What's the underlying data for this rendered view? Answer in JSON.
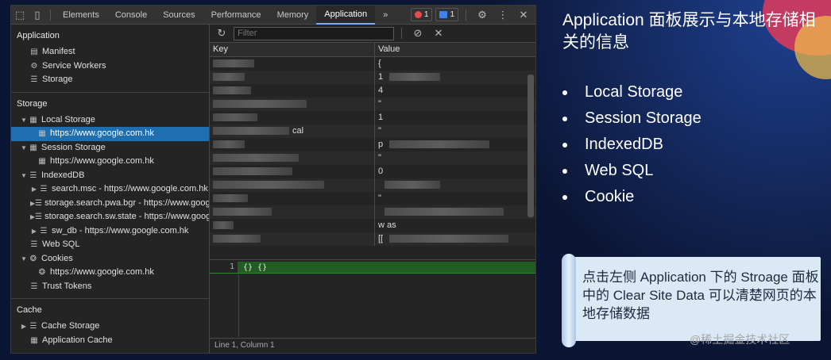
{
  "devtools": {
    "tabs": [
      "Elements",
      "Console",
      "Sources",
      "Performance",
      "Memory",
      "Application"
    ],
    "active_tab": "Application",
    "more_tabs": "»",
    "error_count": "1",
    "message_count": "1",
    "sidebar": {
      "application_header": "Application",
      "application_items": [
        "Manifest",
        "Service Workers",
        "Storage"
      ],
      "storage_header": "Storage",
      "local_storage": "Local Storage",
      "local_storage_origin": "https://www.google.com.hk",
      "session_storage": "Session Storage",
      "session_storage_origin": "https://www.google.com.hk",
      "indexeddb": "IndexedDB",
      "indexeddb_items": [
        "search.msc - https://www.google.com.hk",
        "storage.search.pwa.bgr - https://www.google.com.hk",
        "storage.search.sw.state - https://www.google.com.hk",
        "sw_db - https://www.google.com.hk"
      ],
      "web_sql": "Web SQL",
      "cookies": "Cookies",
      "cookies_origin": "https://www.google.com.hk",
      "trust_tokens": "Trust Tokens",
      "cache_header": "Cache",
      "cache_storage": "Cache Storage",
      "application_cache": "Application Cache"
    },
    "filter_placeholder": "Filter",
    "grid": {
      "columns": [
        "Key",
        "Value"
      ],
      "rows": [
        {
          "key": "",
          "value": "{"
        },
        {
          "key": "",
          "value": "1"
        },
        {
          "key": "",
          "value": "4"
        },
        {
          "key": "",
          "value": "\""
        },
        {
          "key": "",
          "value": "1"
        },
        {
          "key": "cal",
          "value": "\""
        },
        {
          "key": "",
          "value": "p"
        },
        {
          "key": "",
          "value": "\""
        },
        {
          "key": "",
          "value": "0"
        },
        {
          "key": "",
          "value": ""
        },
        {
          "key": "",
          "value": "\""
        },
        {
          "key": "",
          "value": ""
        },
        {
          "key": "",
          "value": "w  as"
        },
        {
          "key": "",
          "value": "[["
        }
      ]
    },
    "preview": {
      "line_number": "1",
      "code": "{}  {}"
    },
    "status_bar": "Line 1, Column 1"
  },
  "slide": {
    "title": "Application 面板展示与本地存储相关的信息",
    "bullets": [
      "Local Storage",
      "Session Storage",
      "IndexedDB",
      "Web SQL",
      "Cookie"
    ],
    "note": "点击左侧 Application 下的 Stroage 面板中的 Clear Site Data 可以清楚网页的本地存储数据",
    "watermark": "@稀土掘金技术社区"
  }
}
